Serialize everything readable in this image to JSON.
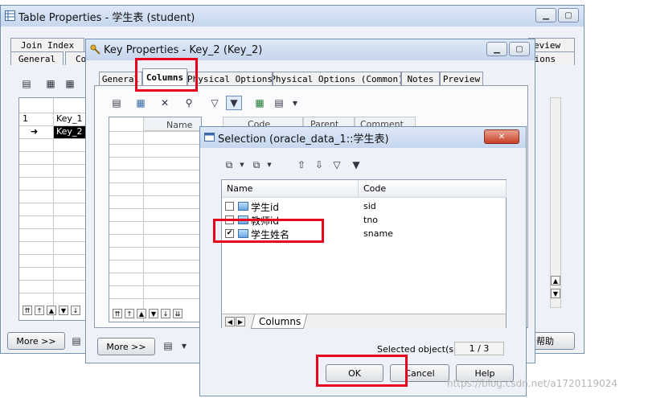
{
  "table_window": {
    "title": "Table Properties - 学生表 (student)",
    "tabs_row1": [
      "Join Index"
    ],
    "tabs_row1_right": "eview",
    "tabs_row2": [
      "General",
      "Co"
    ],
    "tabs_row2_right": "tions",
    "rows": [
      {
        "index": "1",
        "name": "Key_1",
        "marker": ""
      },
      {
        "index": "",
        "name": "Key_2",
        "marker": "➜"
      }
    ],
    "more_label": "More >>",
    "help_label": "帮助"
  },
  "key_window": {
    "title": "Key Properties - Key_2 (Key_2)",
    "tabs": [
      "General",
      "Columns",
      "Physical Options",
      "Physical Options (Common)",
      "Notes",
      "Preview"
    ],
    "active_tab": "Columns",
    "columns": [
      "Name",
      "Code",
      "Parent",
      "Comment"
    ],
    "more_label": "More >>"
  },
  "selection_dialog": {
    "title": "Selection (oracle_data_1::学生表)",
    "header_name": "Name",
    "header_code": "Code",
    "items": [
      {
        "name": "学生id",
        "code": "sid",
        "checked": false
      },
      {
        "name": "教师id",
        "code": "tno",
        "checked": false
      },
      {
        "name": "学生姓名",
        "code": "sname",
        "checked": true
      }
    ],
    "tab_label": "Columns",
    "selected_label": "Selected object(s):",
    "selected_count": "1 / 3",
    "ok_label": "OK",
    "cancel_label": "Cancel",
    "help_label": "Help",
    "checkmark": "✔"
  },
  "watermark": "https://blog.csdn.net/a1720119024"
}
